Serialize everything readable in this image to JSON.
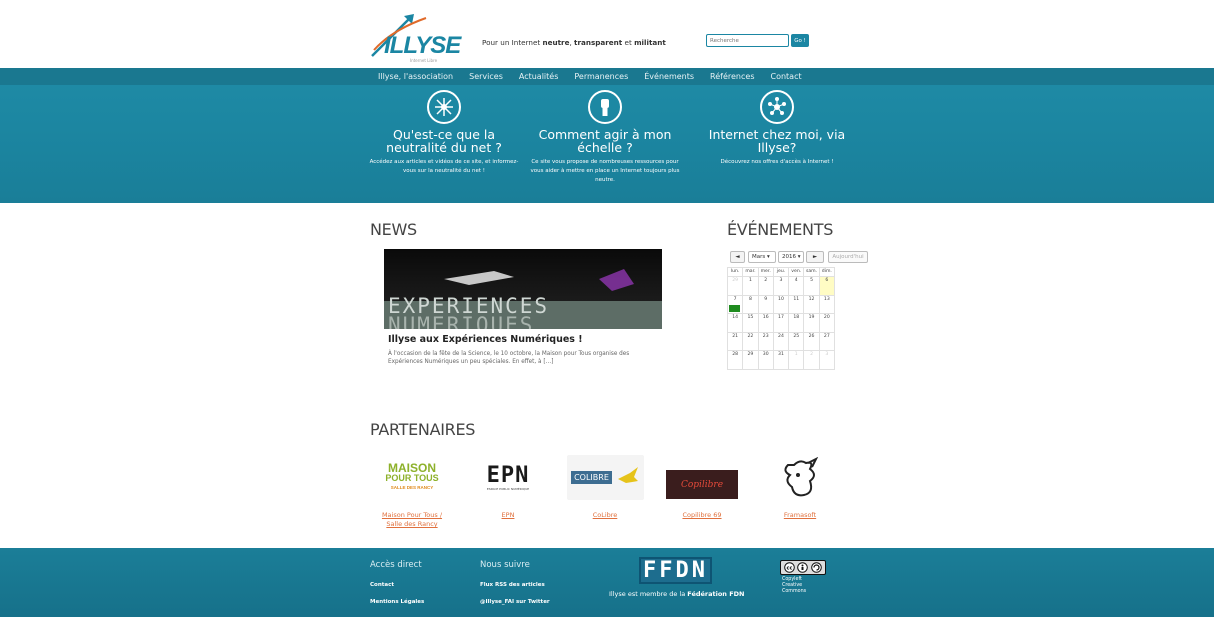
{
  "header": {
    "logo_text": "ILLYSE",
    "logo_sub": "Internet Libre",
    "tagline_pre": "Pour un Internet ",
    "tagline_bold1": "neutre",
    "tagline_mid": ", ",
    "tagline_bold2": "transparent",
    "tagline_and": " et ",
    "tagline_bold3": "militant",
    "search_placeholder": "Recherche",
    "search_button": "Go !"
  },
  "nav": {
    "items": [
      "Illyse, l'association",
      "Services",
      "Actualités",
      "Permanences",
      "Événements",
      "Références",
      "Contact"
    ]
  },
  "features": [
    {
      "icon": "network-globe-icon",
      "title": "Qu'est-ce que la neutralité du net ?",
      "desc": "Accédez aux articles et vidéos de ce site, et informez-vous sur la neutralité du net !"
    },
    {
      "icon": "raised-fist-icon",
      "title": "Comment agir à mon échelle ?",
      "desc": "Ce site vous propose de nombreuses ressources pour vous aider à mettre en place un Internet toujours plus neutre."
    },
    {
      "icon": "network-hub-icon",
      "title": "Internet chez moi, via Illyse?",
      "desc": "Découvrez nos offres d'accès à Internet !"
    }
  ],
  "news": {
    "heading": "NEWS",
    "image_line1": "EXPERIENCES",
    "image_line2": "NUMERIQUES",
    "title": "Illyse aux Expériences Numériques !",
    "excerpt": "À l'occasion de la fête de la Science, le 10 octobre, la Maison pour Tous organise des Expériences Numériques un peu spéciales. En effet, à […]"
  },
  "events": {
    "heading": "ÉVÉNEMENTS",
    "prev": "◄",
    "month": "Mars ▾",
    "year": "2016 ▾",
    "next": "►",
    "today_button": "Aujourd'hui",
    "weekdays": [
      "lun.",
      "mar.",
      "mer.",
      "jeu.",
      "ven.",
      "sam.",
      "dim."
    ],
    "weeks": [
      [
        "29",
        "1",
        "2",
        "3",
        "4",
        "5",
        "6"
      ],
      [
        "7",
        "8",
        "9",
        "10",
        "11",
        "12",
        "13"
      ],
      [
        "14",
        "15",
        "16",
        "17",
        "18",
        "19",
        "20"
      ],
      [
        "21",
        "22",
        "23",
        "24",
        "25",
        "26",
        "27"
      ],
      [
        "28",
        "29",
        "30",
        "31",
        "1",
        "2",
        "3"
      ]
    ]
  },
  "partners": {
    "heading": "PARTENAIRES",
    "items": [
      {
        "logo_line1": "MAISON",
        "logo_line2": "POUR TOUS",
        "logo_line3": "SALLE DES RANCY",
        "link": "Maison Pour Tous / Salle des Rancy"
      },
      {
        "logo_line1": "EPN",
        "logo_line2": "ESPACE PUBLIC NUMÉRIQUE",
        "link": "EPN"
      },
      {
        "logo_line1": "COLIBRE",
        "link": "CoLibre"
      },
      {
        "logo_line1": "Copilibre",
        "link": "Copilibre 69"
      },
      {
        "logo_line1": "",
        "link": "Framasoft"
      }
    ]
  },
  "footer": {
    "acces_heading": "Accès direct",
    "acces_links": [
      "Contact",
      "Mentions Légales"
    ],
    "suivre_heading": "Nous suivre",
    "suivre_links": [
      "Flux RSS des articles",
      "@Illyse_FAI sur Twitter"
    ],
    "ffdn_logo": "FFDN",
    "ffdn_pre": "Illyse est membre de la ",
    "ffdn_bold": "Fédération FDN",
    "cc_lines": [
      "Copyleft",
      "Creative",
      "Commons"
    ]
  }
}
